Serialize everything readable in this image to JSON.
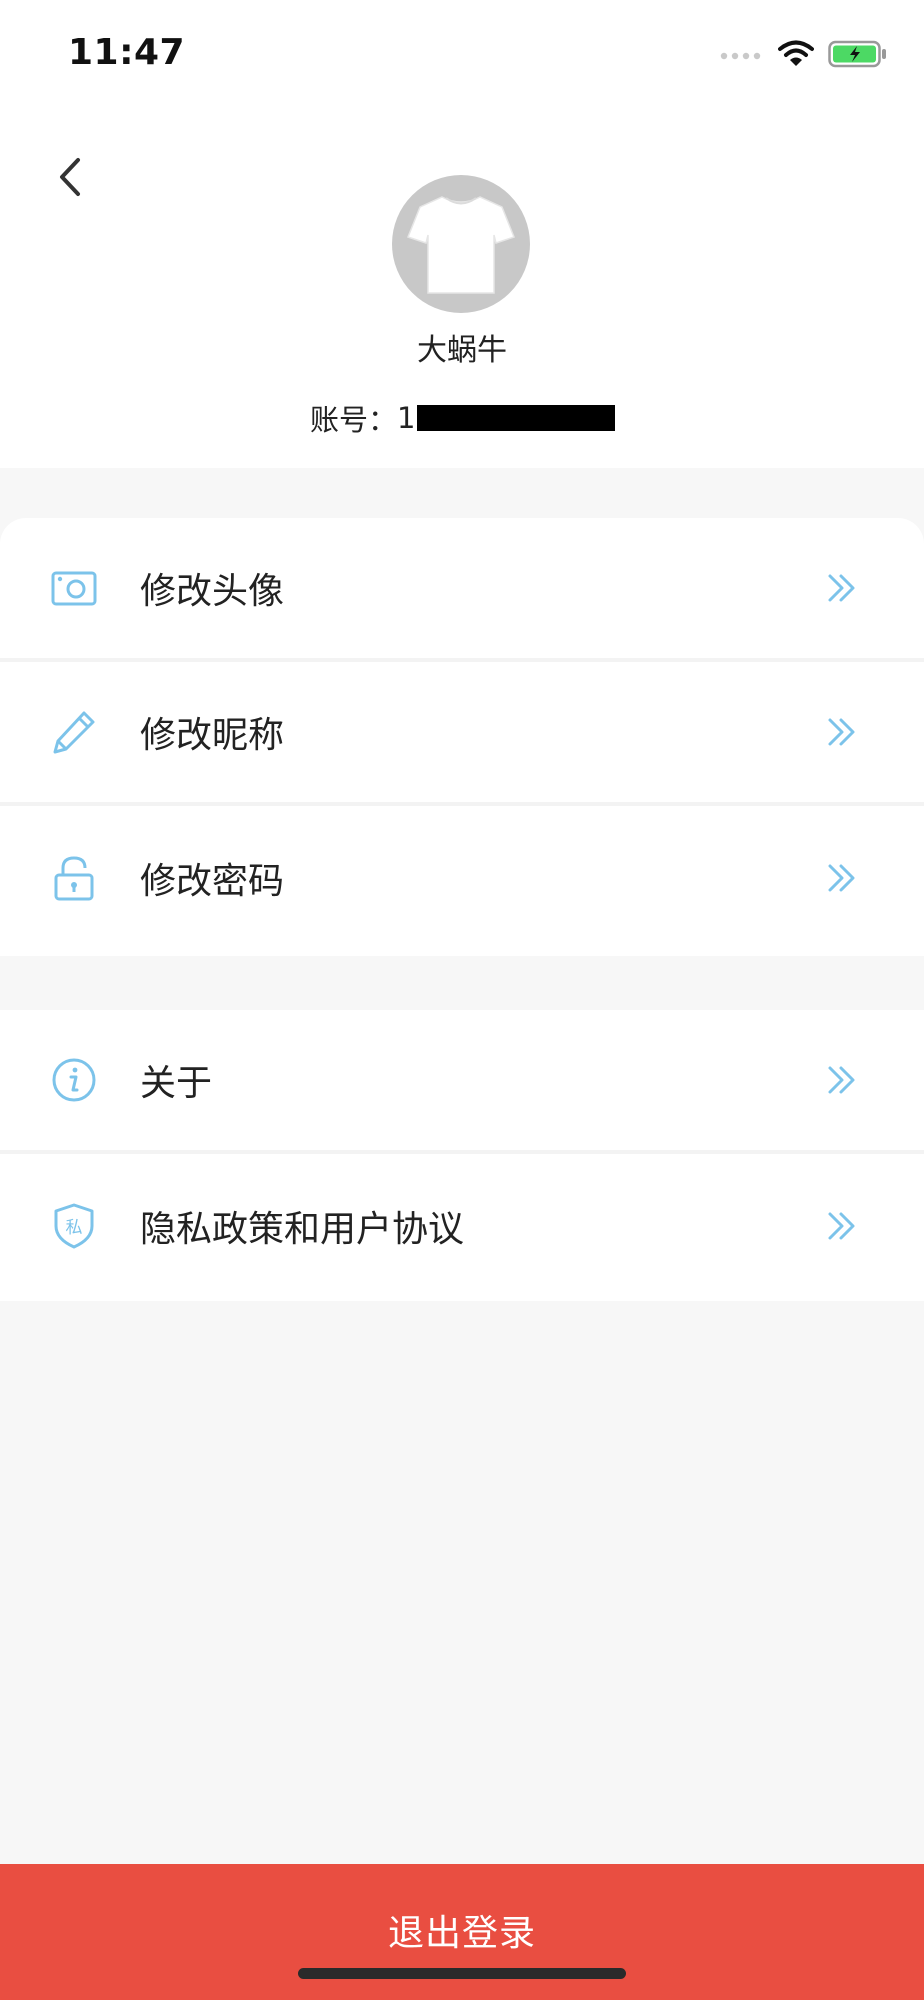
{
  "status_bar": {
    "time": "11:47",
    "icons": [
      "cellular-signal-icon",
      "wifi-icon",
      "battery-charging-icon"
    ],
    "battery_color": "#4cd964"
  },
  "header": {
    "back_icon": "chevron-left-icon",
    "avatar_icon": "tshirt-avatar",
    "nickname": "大蜗牛",
    "account_label": "账号：",
    "account_value_visible": "1"
  },
  "menu_group_1": {
    "items": [
      {
        "label": "修改头像",
        "icon": "camera-icon"
      },
      {
        "label": "修改昵称",
        "icon": "pencil-icon"
      },
      {
        "label": "修改密码",
        "icon": "lock-icon"
      }
    ]
  },
  "menu_group_2": {
    "items": [
      {
        "label": "关于",
        "icon": "info-icon"
      },
      {
        "label": "隐私政策和用户协议",
        "icon": "privacy-shield-icon",
        "icon_text": "私"
      }
    ]
  },
  "logout": {
    "label": "退出登录"
  },
  "colors": {
    "accent_icon": "#7cc3ea",
    "logout_bg": "#e94e41",
    "page_bg": "#f7f7f7"
  }
}
